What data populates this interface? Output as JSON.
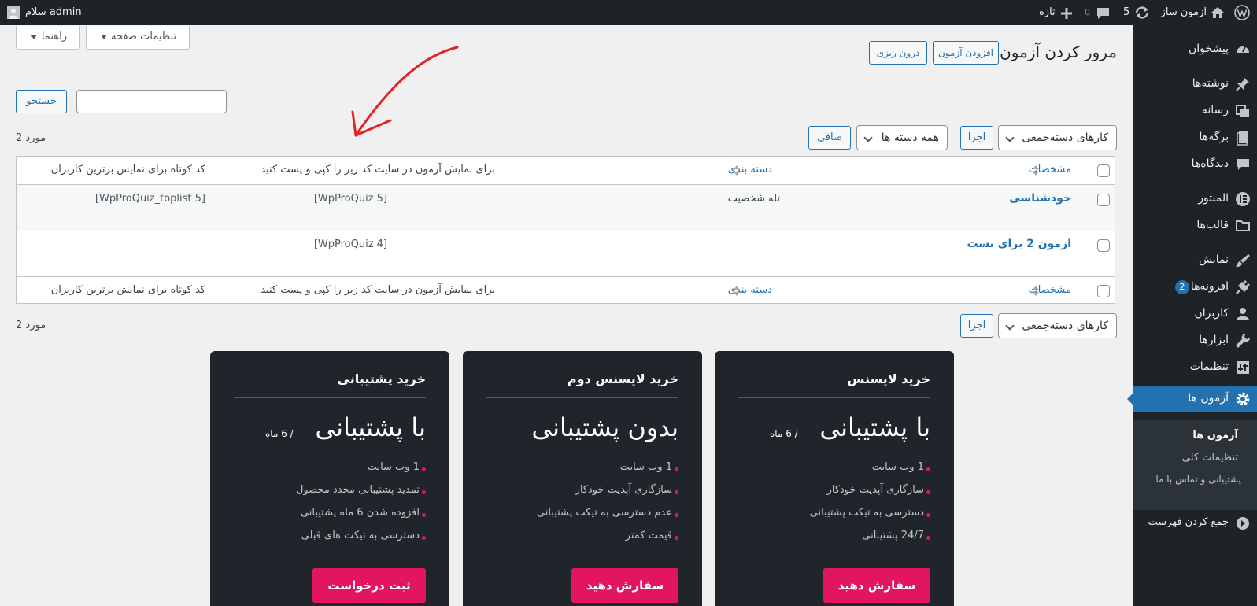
{
  "admin_bar": {
    "site_name": "آزمون ساز",
    "updates_count": "5",
    "comments_count": "0",
    "new_label": "تازه",
    "greeting": "سلام admin"
  },
  "sidebar": {
    "items": [
      {
        "label": "پیشخوان",
        "icon": "dashboard-icon"
      },
      {
        "label": "نوشته‌ها",
        "icon": "pin-icon"
      },
      {
        "label": "رسانه",
        "icon": "media-icon"
      },
      {
        "label": "برگه‌ها",
        "icon": "page-icon"
      },
      {
        "label": "دیدگاه‌ها",
        "icon": "comment-icon"
      },
      {
        "label": "المنتور",
        "icon": "elementor-icon"
      },
      {
        "label": "قالب‌ها",
        "icon": "folder-icon"
      },
      {
        "label": "نمایش",
        "icon": "brush-icon"
      },
      {
        "label": "افزونه‌ها",
        "icon": "plugin-icon",
        "badge": "2"
      },
      {
        "label": "کاربران",
        "icon": "user-icon"
      },
      {
        "label": "ابزارها",
        "icon": "wrench-icon"
      },
      {
        "label": "تنظیمات",
        "icon": "settings-icon"
      },
      {
        "label": "آزمون ها",
        "icon": "gear-icon"
      },
      {
        "label": "جمع کردن فهرست",
        "icon": "collapse-icon"
      }
    ],
    "submenu": [
      "آزمون ها",
      "تنظیمات کلی",
      "پشتیبانی و تماس با ما"
    ]
  },
  "screen_options": {
    "screen_settings": "تنظیمات صفحه",
    "help": "راهنما"
  },
  "page": {
    "title": "مرور کردن آزمون",
    "add_quiz": "افزودن آزمون",
    "import": "درون ریزی"
  },
  "search": {
    "button": "جستجو",
    "value": ""
  },
  "filters": {
    "bulk_actions": "کارهای دسته‌جمعی",
    "apply": "اجرا",
    "all_categories": "همه دسته ها",
    "filter": "صافی",
    "items_count": "2 مورد"
  },
  "table": {
    "columns": {
      "name": "مشخصات",
      "category": "دسته بندی",
      "shortcode": "برای نمایش آزمون در سایت کد زیر را کپی و پست کنید",
      "toplist": "کد کوتاه برای نمایش برترین کاربران"
    },
    "rows": [
      {
        "name": "خودشناسی",
        "category": "تله شخصیت",
        "shortcode": "[WpProQuiz 5]",
        "toplist": "[WpProQuiz_toplist 5]"
      },
      {
        "name": "ازمون 2 برای تست",
        "category": "",
        "shortcode": "[WpProQuiz 4]",
        "toplist": ""
      }
    ]
  },
  "cards": [
    {
      "title": "خرید لایسنس",
      "headline": "با پشتیبانی",
      "period": "/ 6 ماه",
      "features": [
        "1 وب سایت",
        "سازگاری آپدیت خودکار",
        "دسترسی به تیکت پشتیبانی",
        "24/7 پشتیبانی"
      ],
      "button": "سفارش دهید"
    },
    {
      "title": "خرید لایسنس دوم",
      "headline": "بدون پشتیبانی",
      "period": "",
      "features": [
        "1 وب سایت",
        "سازگاری آپدیت خودکار",
        "عدم دسترسی به تیکت پشتیبانی",
        "قیمت کمتر"
      ],
      "button": "سفارش دهید"
    },
    {
      "title": "خرید پشتیبانی",
      "headline": "با پشتیبانی",
      "period": "/ 6 ماه",
      "features": [
        "1 وب سایت",
        "تمدید پشتیبانی مجدد محصول",
        "افزوده شدن 6 ماه پشتیبانی",
        "دسترسی به تیکت های قبلی"
      ],
      "button": "ثبت درخواست"
    }
  ],
  "colors": {
    "admin_dark": "#1d2327",
    "wp_blue": "#2271b1",
    "card_accent": "#e2165e",
    "annotation_arrow": "#e02424"
  }
}
